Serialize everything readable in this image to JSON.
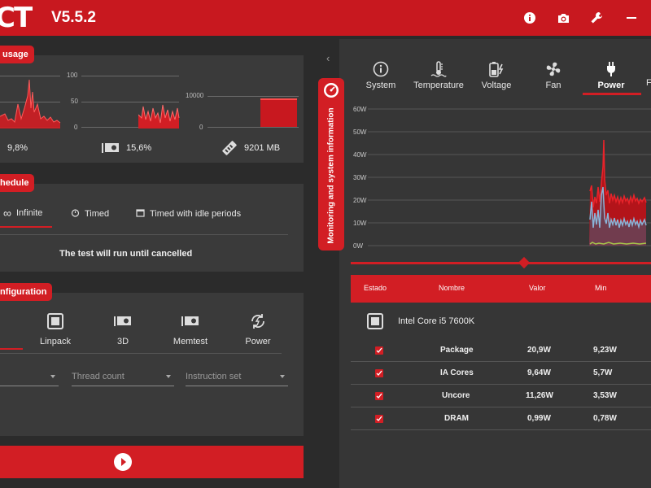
{
  "app": {
    "logo": "CT",
    "version": "V5.5.2"
  },
  "usage": {
    "tag": "usage",
    "cpu": {
      "value": "9,8%"
    },
    "gpu": {
      "axis_top": "100",
      "axis_mid": "50",
      "axis_zero": "0",
      "value": "15,6%"
    },
    "mem": {
      "axis_top": "10000",
      "axis_zero": "0",
      "value": "9201 MB",
      "fill_fraction": 0.92
    }
  },
  "schedule": {
    "tag": "hedule",
    "tabs": [
      {
        "label": "Infinite",
        "icon": "infinity-icon",
        "active": true
      },
      {
        "label": "Timed",
        "icon": "timer-icon"
      },
      {
        "label": "Timed with idle periods",
        "icon": "calendar-icon"
      }
    ],
    "message": "The test will run until cancelled"
  },
  "config": {
    "tag": "nfiguration",
    "tools": [
      {
        "label": "Linpack",
        "icon": "cpu-chip-icon"
      },
      {
        "label": "3D",
        "icon": "gpu-card-icon"
      },
      {
        "label": "Memtest",
        "icon": "memory-icon"
      },
      {
        "label": "Power",
        "icon": "power-cycle-icon"
      }
    ],
    "thread_count": "Thread count",
    "instruction_set": "Instruction set"
  },
  "monitor": {
    "side_tab": "Monitoring and system information",
    "tabs": [
      {
        "label": "System",
        "icon": "info-icon"
      },
      {
        "label": "Temperature",
        "icon": "thermometer-icon"
      },
      {
        "label": "Voltage",
        "icon": "battery-bolt-icon"
      },
      {
        "label": "Fan",
        "icon": "fan-icon"
      },
      {
        "label": "Power",
        "icon": "plug-icon",
        "active": true
      }
    ],
    "y_labels": [
      "60W",
      "50W",
      "40W",
      "30W",
      "20W",
      "10W",
      "0W"
    ],
    "table": {
      "headers": [
        "Estado",
        "Nombre",
        "Valor",
        "Min"
      ],
      "device": "Intel Core i5 7600K",
      "rows": [
        {
          "name": "Package",
          "value": "20,9W",
          "min": "9,23W"
        },
        {
          "name": "IA Cores",
          "value": "9,64W",
          "min": "5,7W"
        },
        {
          "name": "Uncore",
          "value": "11,26W",
          "min": "3,53W"
        },
        {
          "name": "DRAM",
          "value": "0,99W",
          "min": "0,78W"
        }
      ]
    }
  },
  "colors": {
    "accent": "#d21e24",
    "bar": "#c8181f",
    "blue_series": "#8ab4d8",
    "green_series": "#a6c84a"
  }
}
